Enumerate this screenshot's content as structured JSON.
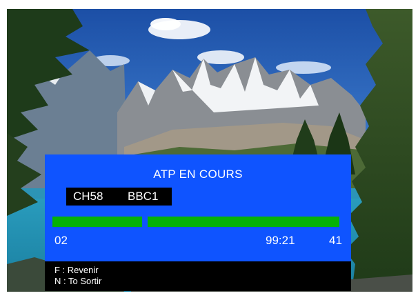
{
  "osd": {
    "title": "ATP EN COURS",
    "channel_number": "CH58",
    "channel_name": "BBC1",
    "progress_left_value": "02",
    "progress_time": "99:21",
    "progress_right_value": "41"
  },
  "help": {
    "line1": "F : Revenir",
    "line2": "N : To Sortir"
  },
  "colors": {
    "panel_blue": "#0f54ff",
    "progress_green": "#05b205",
    "help_bar": "#000000"
  }
}
